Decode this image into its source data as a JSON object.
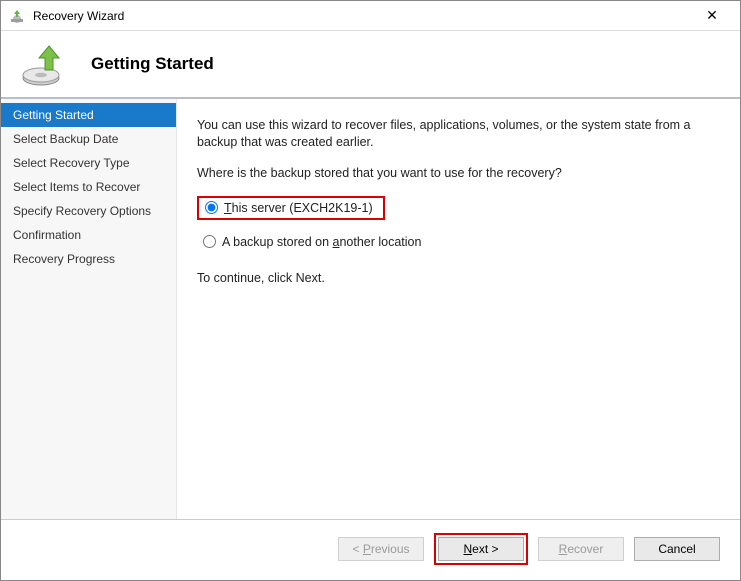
{
  "window": {
    "title": "Recovery Wizard",
    "close_label": "✕"
  },
  "header": {
    "heading": "Getting Started"
  },
  "sidebar": {
    "items": [
      {
        "label": "Getting Started",
        "active": true
      },
      {
        "label": "Select Backup Date",
        "active": false
      },
      {
        "label": "Select Recovery Type",
        "active": false
      },
      {
        "label": "Select Items to Recover",
        "active": false
      },
      {
        "label": "Specify Recovery Options",
        "active": false
      },
      {
        "label": "Confirmation",
        "active": false
      },
      {
        "label": "Recovery Progress",
        "active": false
      }
    ]
  },
  "content": {
    "intro": "You can use this wizard to recover files, applications, volumes, or the system state from a backup that was created earlier.",
    "question": "Where is the backup stored that you want to use for the recovery?",
    "options": {
      "this_server_prefix": "T",
      "this_server_rest": "his server (EXCH2K19-1)",
      "another_prefix": "A backup stored on ",
      "another_u": "a",
      "another_rest": "nother location"
    },
    "continue_text": "To continue, click Next."
  },
  "footer": {
    "previous_u": "P",
    "previous_rest": "revious",
    "next_u": "N",
    "next_rest": "ext >",
    "recover_u": "R",
    "recover_rest": "ecover",
    "cancel": "Cancel"
  }
}
